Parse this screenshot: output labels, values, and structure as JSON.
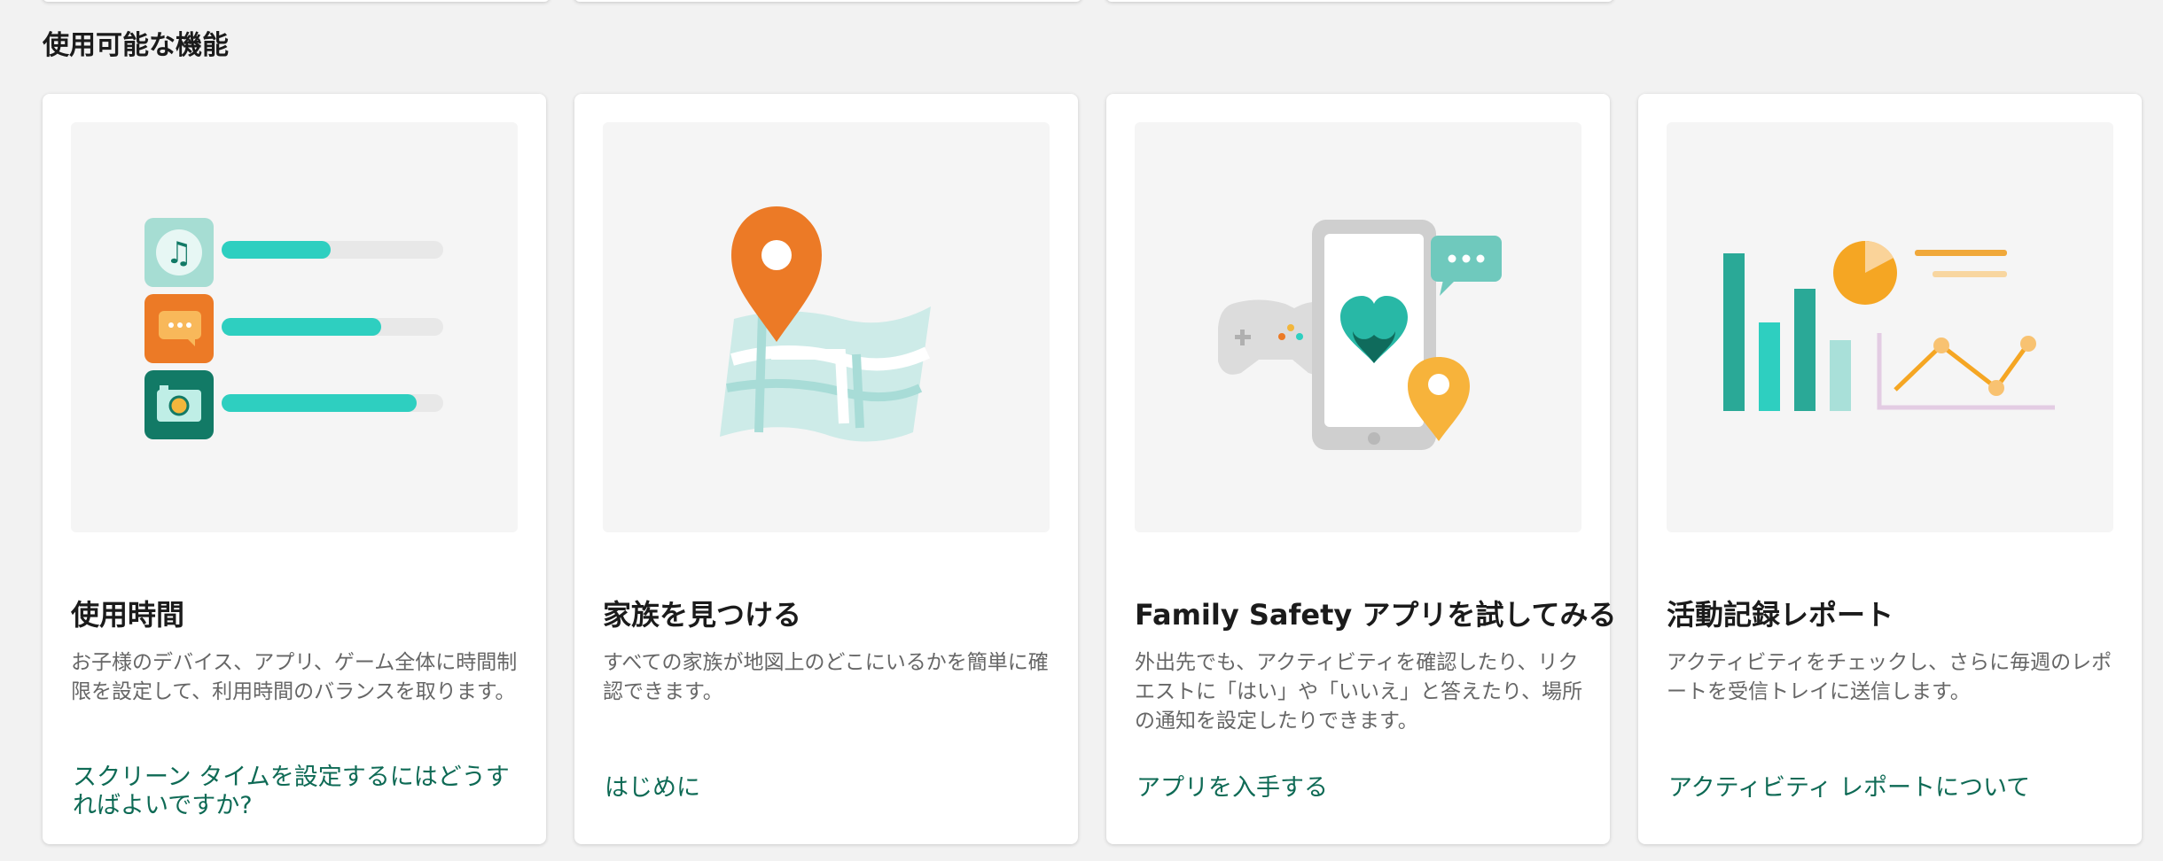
{
  "section": {
    "title": "使用可能な機能"
  },
  "cards": [
    {
      "title": "使用時間",
      "description": "お子様のデバイス、アプリ、ゲーム全体に時間制限を設定して、利用時間のバランスを取ります。",
      "link": "スクリーン タイムを設定するにはどうすればよいですか?",
      "progress": [
        0.49,
        0.72,
        0.88
      ]
    },
    {
      "title": "家族を見つける",
      "description": "すべての家族が地図上のどこにいるかを簡単に確認できます。",
      "link": "はじめに"
    },
    {
      "title": "Family Safety アプリを試してみる",
      "description": "外出先でも、アクティビティを確認したり、リクエストに「はい」や「いいえ」と答えたり、場所の通知を設定したりできます。",
      "link": "アプリを入手する"
    },
    {
      "title": "活動記録レポート",
      "description": "アクティビティをチェックし、さらに毎週のレポートを受信トレイに送信します。",
      "link": "アクティビティ レポートについて"
    }
  ],
  "colors": {
    "page_bg": "#f2f2f2",
    "link": "#0e6a55",
    "teal": "#2ecfc0",
    "orange": "#ec7a26",
    "yellow": "#f7b33b"
  }
}
